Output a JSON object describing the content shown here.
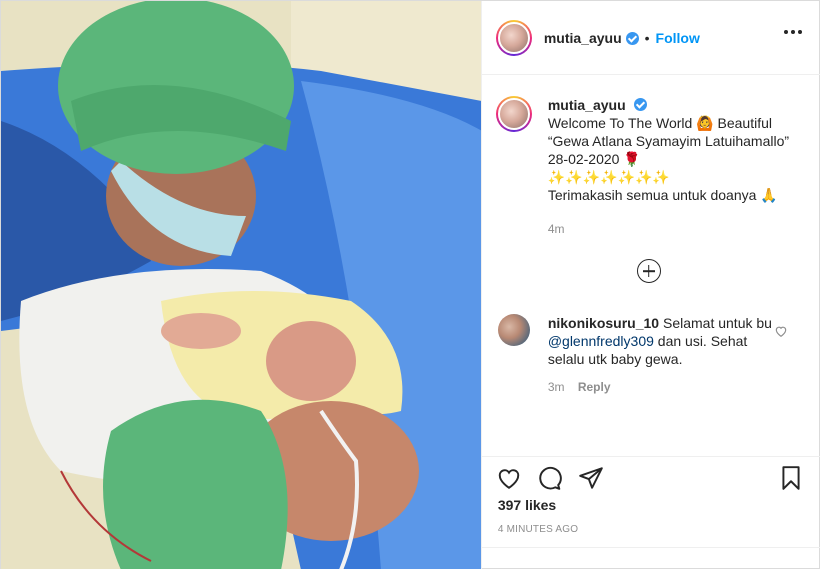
{
  "post": {
    "username": "mutia_ayuu",
    "verified": true,
    "separator": "•",
    "follow_label": "Follow",
    "more_icon": "more-horizontal-icon"
  },
  "caption": {
    "username": "mutia_ayuu",
    "line1": "Welcome To The World 🙆 Beautiful",
    "line2": "“Gewa Atlana Syamayim Latuihamallo”",
    "line3": "28-02-2020 🌹",
    "line4": "✨✨✨✨✨✨✨",
    "line5": "Terimakasih semua untuk doanya 🙏",
    "time": "4m"
  },
  "load_more": {
    "icon": "plus-circle-icon"
  },
  "comments": [
    {
      "username": "nikonikosuru_10",
      "text_before": "Selamat untuk bu",
      "mention": "@glennfredly309",
      "text_after": "dan usi. Sehat selalu utk baby gewa.",
      "time": "3m",
      "reply_label": "Reply"
    }
  ],
  "actions": {
    "like_icon": "heart-icon",
    "comment_icon": "comment-icon",
    "share_icon": "send-icon",
    "save_icon": "bookmark-icon",
    "likes": "397 likes",
    "time": "4 MINUTES AGO"
  },
  "colors": {
    "accent": "#0095f6",
    "verified": "#3897f0",
    "text": "#262626",
    "muted": "#8e8e8e",
    "scrub_cap": "#5bb67a",
    "scrub_top": "#2b63b5"
  }
}
